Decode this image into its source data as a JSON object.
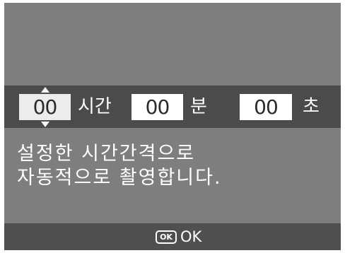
{
  "timer": {
    "hours_value": "00",
    "hours_unit": "시간",
    "minutes_value": "00",
    "minutes_unit": "분",
    "seconds_value": "00",
    "seconds_unit": "초"
  },
  "message": {
    "line1": "설정한 시간간격으로",
    "line2": "자동적으로 촬영합니다."
  },
  "footer": {
    "ok_icon_text": "OK",
    "ok_label": "OK"
  },
  "icons": {
    "up": "up-arrow-icon",
    "down": "down-arrow-icon",
    "ok": "ok-button-icon"
  },
  "colors": {
    "screen_bg": "#7e7e7e",
    "bar_bg": "#4b4b4b",
    "footer_bg": "#4f4f4f",
    "field_bg": "#ffffff",
    "active_field_bg": "#ececec",
    "text_light": "#ffffff",
    "text_dark": "#2b2b2b"
  }
}
